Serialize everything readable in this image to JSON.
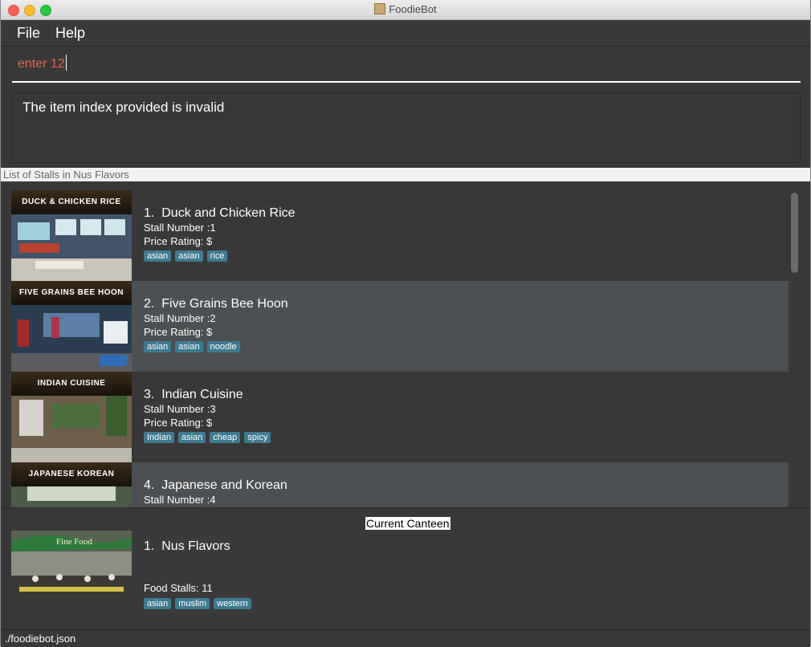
{
  "window": {
    "title": "FoodieBot"
  },
  "menu": {
    "file": "File",
    "help": "Help"
  },
  "command": {
    "value": "enter 12"
  },
  "result": {
    "message": "The item index provided is invalid"
  },
  "stall_list": {
    "title": "List of Stalls in Nus Flavors",
    "stall_number_label": "Stall Number :",
    "price_label": "Price Rating: ",
    "items": [
      {
        "index": "1.",
        "name": "Duck and Chicken Rice",
        "sign": "DUCK & CHICKEN RICE",
        "stall_number": "1",
        "price": "$",
        "tags": [
          "asian",
          "asian",
          "rice"
        ]
      },
      {
        "index": "2.",
        "name": "Five Grains Bee Hoon",
        "sign": "FIVE GRAINS BEE HOON",
        "stall_number": "2",
        "price": "$",
        "tags": [
          "asian",
          "asian",
          "noodle"
        ]
      },
      {
        "index": "3.",
        "name": "Indian Cuisine",
        "sign": "INDIAN CUISINE",
        "stall_number": "3",
        "price": "$",
        "tags": [
          "Indian",
          "asian",
          "cheap",
          "spicy"
        ]
      },
      {
        "index": "4.",
        "name": "Japanese and Korean",
        "sign": "JAPANESE KOREAN",
        "stall_number": "4",
        "price": "$",
        "tags": []
      }
    ]
  },
  "current_canteen": {
    "title": "Current Canteen",
    "index": "1.",
    "name": "Nus Flavors",
    "sign": "Fine Food",
    "food_stalls_label": "Food Stalls: ",
    "food_stalls": "11",
    "tags": [
      "asian",
      "muslim",
      "western"
    ]
  },
  "status": {
    "path": "./foodiebot.json"
  },
  "colors": {
    "background": "#383838",
    "row_alt": "#4c5053",
    "tag": "#3e7b91",
    "command_text": "#e2624d"
  },
  "icons": {
    "close": "close-button-icon",
    "minimize": "minimize-button-icon",
    "maximize": "maximize-button-icon",
    "app": "app-icon"
  }
}
